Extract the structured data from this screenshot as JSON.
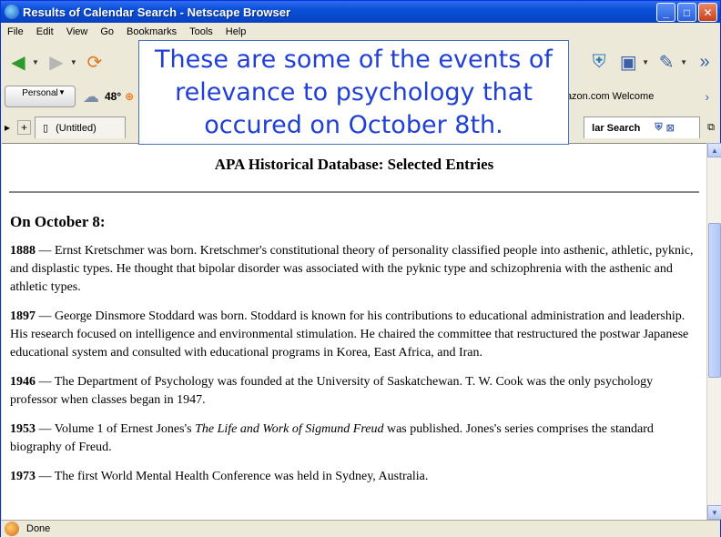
{
  "window": {
    "title": "Results of Calendar Search - Netscape Browser"
  },
  "menu": [
    "File",
    "Edit",
    "View",
    "Go",
    "Bookmarks",
    "Tools",
    "Help"
  ],
  "personal_toolbar": {
    "personal_label": "Personal",
    "temperature": "48°",
    "bookmark_label": "azon.com Welcome"
  },
  "tabs": {
    "untitled": "(Untitled)",
    "active": "lar Search"
  },
  "callout": {
    "text": "These are some of the events of relevance to psychology that occured on October 8th."
  },
  "document": {
    "title": "APA Historical Database: Selected Entries",
    "date_heading": "On October 8:",
    "entries": [
      {
        "year": "1888",
        "text": " — Ernst Kretschmer was born. Kretschmer's constitutional theory of personality classified people into asthenic, athletic, pyknic, and displastic types. He thought that bipolar disorder was associated with the pyknic type and schizophrenia with the asthenic and athletic types."
      },
      {
        "year": "1897",
        "text": " — George Dinsmore Stoddard was born. Stoddard is known for his contributions to educational administration and leadership. His research focused on intelligence and environmental stimulation. He chaired the committee that restructured the postwar Japanese educational system and consulted with educational programs in Korea, East Africa, and Iran."
      },
      {
        "year": "1946",
        "text": " — The Department of Psychology was founded at the University of Saskatchewan. T. W. Cook was the only psychology professor when classes began in 1947."
      },
      {
        "year": "1953",
        "text_before": " — Volume 1 of Ernest Jones's ",
        "title": "The Life and Work of Sigmund Freud",
        "text_after": " was published. Jones's series comprises the standard biography of Freud."
      },
      {
        "year": "1973",
        "text": " — The first World Mental Health Conference was held in Sydney, Australia."
      }
    ]
  },
  "status": {
    "text": "Done"
  }
}
